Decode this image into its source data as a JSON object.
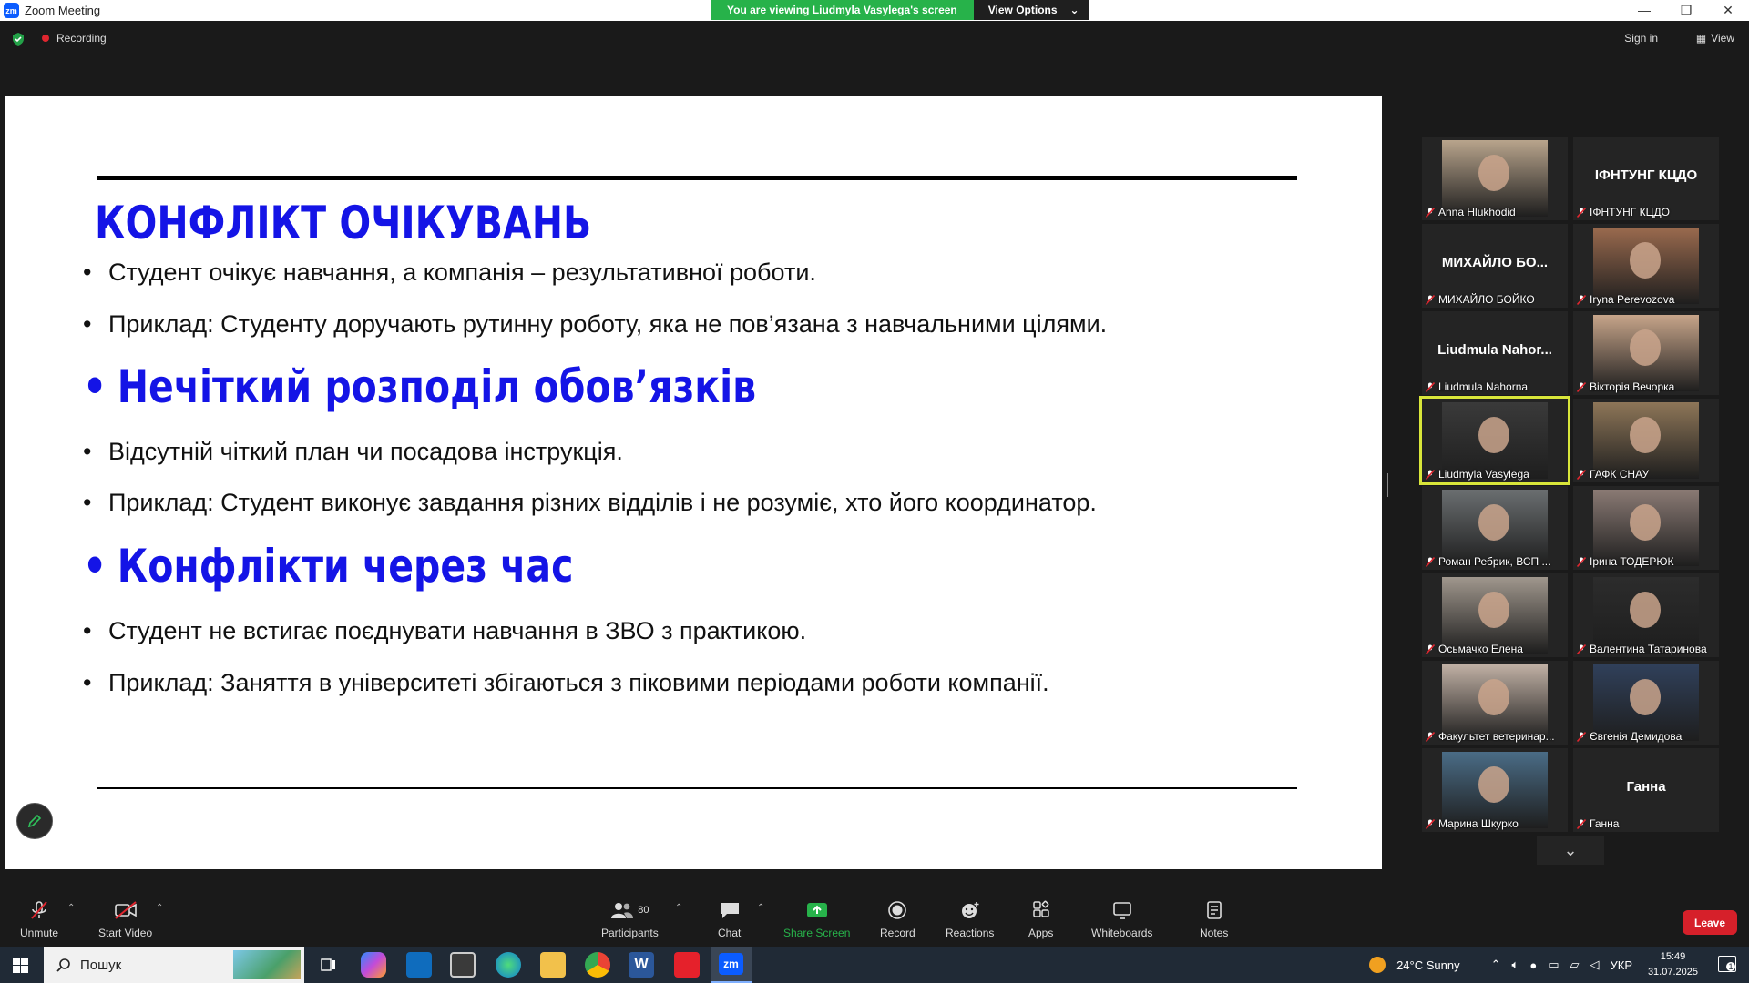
{
  "window": {
    "title": "Zoom Meeting"
  },
  "share_banner": {
    "text": "You are viewing Liudmyla Vasylega's screen",
    "options_label": "View Options"
  },
  "topbar": {
    "recording_label": "Recording",
    "signin_label": "Sign in",
    "view_label": "View"
  },
  "slide": {
    "title": "КОНФЛІКТ ОЧІКУВАНЬ",
    "bullets_1": [
      "Студент очікує навчання, а компанія – результативної роботи.",
      "Приклад: Студенту доручають рутинну роботу, яка не пов’язана з навчальними цілями."
    ],
    "heading_2": "Нечіткий розподіл обов’язків",
    "bullets_2": [
      "Відсутній чіткий план чи посадова інструкція.",
      "Приклад: Студент виконує завдання різних відділів і не розуміє, хто його координатор."
    ],
    "heading_3": "Конфлікти через час",
    "bullets_3": [
      "Студент не встигає поєднувати навчання в ЗВО з практикою.",
      "Приклад: Заняття в університеті збігаються з піковими періодами роботи компанії."
    ],
    "bullet_char": "•"
  },
  "participants": [
    {
      "name": "Anna Hlukhodid",
      "video": true,
      "color": "#b8a48c"
    },
    {
      "name": "ІФНТУНГ КЦДО",
      "big": "ІФНТУНГ КЦДО",
      "video": false
    },
    {
      "name": "МИХАЙЛО БОЙКО",
      "big": "МИХАЙЛО БО...",
      "video": false
    },
    {
      "name": "Iryna Perevozova",
      "video": true,
      "color": "#9a6a4e"
    },
    {
      "name": "Liudmula Nahorna",
      "big": "Liudmula  Nahor...",
      "video": false
    },
    {
      "name": "Вікторія Вечорка",
      "video": true,
      "color": "#c7a58a"
    },
    {
      "name": "Liudmyla Vasylega",
      "video": true,
      "color": "#3a3a3a",
      "active": true
    },
    {
      "name": "ГАФК СНАУ",
      "video": true,
      "color": "#8e7658"
    },
    {
      "name": "Роман Ребрик, ВСП ...",
      "video": true,
      "color": "#6a6e70"
    },
    {
      "name": "Ірина ТОДЕРЮК",
      "video": true,
      "color": "#8a7a74"
    },
    {
      "name": "Осьмачко Елена",
      "video": true,
      "color": "#a0978d"
    },
    {
      "name": "Валентина Татаринова",
      "video": true,
      "color": "#2c2c2c"
    },
    {
      "name": "Факультет ветеринар...",
      "video": true,
      "color": "#c0b0a4"
    },
    {
      "name": "Євгенія Демидова",
      "video": true,
      "color": "#30405a"
    },
    {
      "name": "Марина Шкурко",
      "video": true,
      "color": "#4a6c86"
    },
    {
      "name": "Ганна",
      "big": "Ганна",
      "video": false
    }
  ],
  "toolbar": {
    "unmute": "Unmute",
    "start_video": "Start Video",
    "participants": "Participants",
    "participants_count": "80",
    "chat": "Chat",
    "share_screen": "Share Screen",
    "record": "Record",
    "reactions": "Reactions",
    "apps": "Apps",
    "whiteboards": "Whiteboards",
    "notes": "Notes",
    "leave": "Leave"
  },
  "taskbar": {
    "search_placeholder": "Пошук",
    "weather": "24°C  Sunny",
    "language": "УКР",
    "time": "15:49",
    "date": "31.07.2025",
    "notification_count": "1"
  },
  "colors": {
    "accent_blue": "#1414e6",
    "share_green": "#27b24a",
    "leave_red": "#d6202a",
    "active_outline": "#d9e63a"
  }
}
